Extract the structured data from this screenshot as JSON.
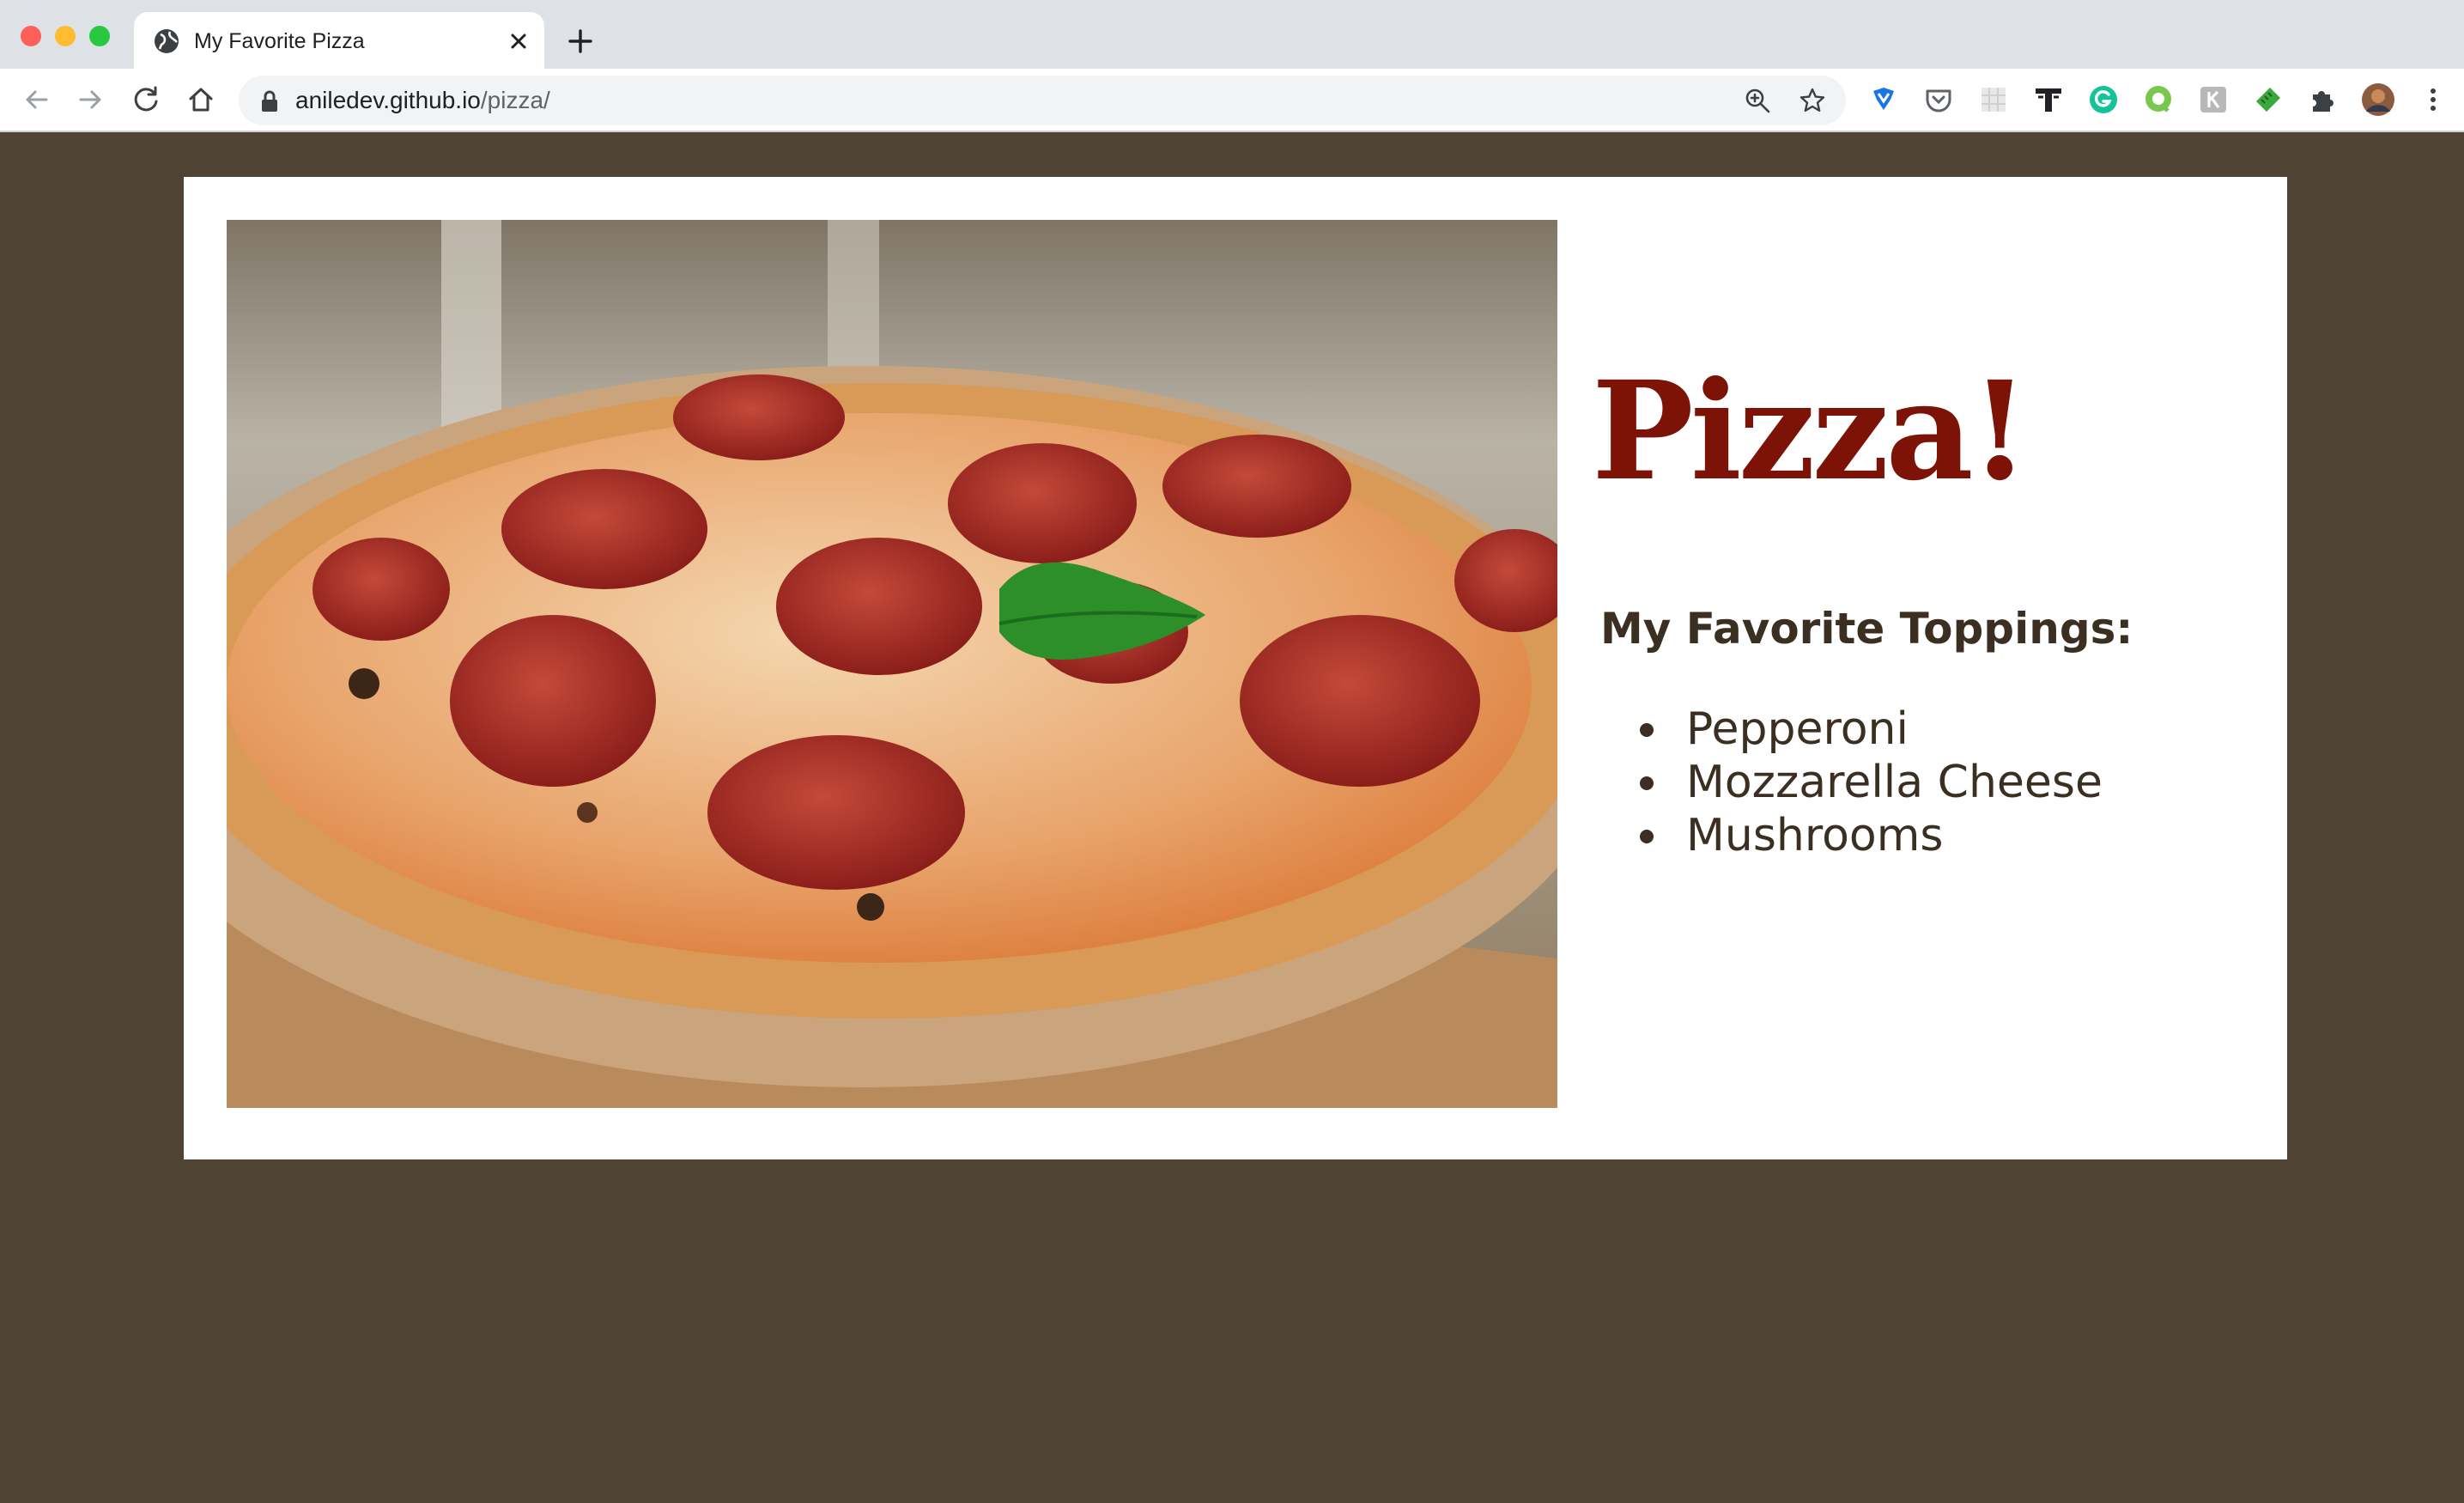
{
  "browser": {
    "tab": {
      "title": "My Favorite Pizza",
      "favicon": "globe-icon"
    },
    "new_tab_icon": "plus-icon",
    "toolbar": {
      "back_icon": "arrow-left-icon",
      "forward_icon": "arrow-right-icon",
      "reload_icon": "reload-icon",
      "home_icon": "home-icon"
    },
    "address": {
      "host": "aniledev.github.io",
      "path": "/pizza/",
      "lock_icon": "lock-icon"
    },
    "extensions": [
      "zoom-icon",
      "star-icon",
      "vpn-shield-icon",
      "pocket-icon",
      "grid-extension-icon",
      "text-t-icon",
      "grammarly-icon",
      "chat-bubble-icon",
      "k-extension-icon",
      "ruler-extension-icon",
      "puzzle-icon",
      "profile-avatar",
      "kebab-menu-icon"
    ]
  },
  "page": {
    "background_color": "#4f4434",
    "heading": "Pizza!",
    "heading_color": "#7c1306",
    "subheading": "My Favorite Toppings:",
    "toppings": [
      "Pepperoni",
      "Mozzarella Cheese",
      "Mushrooms"
    ],
    "image_subject": "pepperoni pizza with basil leaf on wooden board"
  }
}
